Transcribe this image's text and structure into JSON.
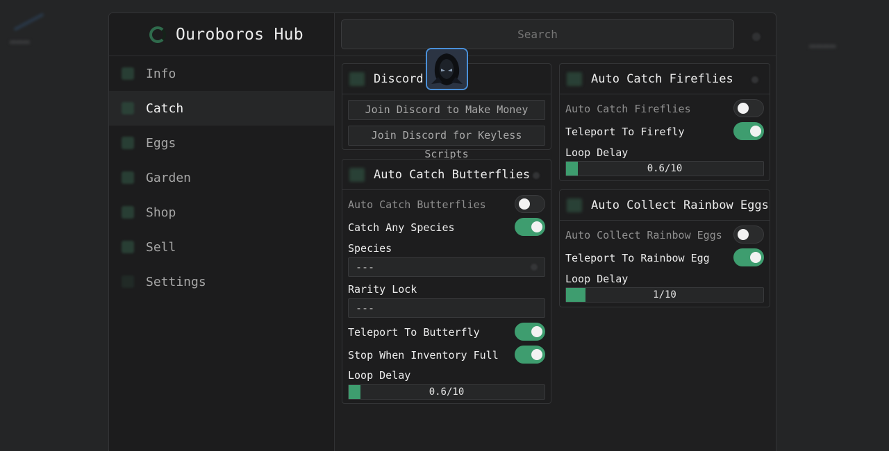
{
  "app": {
    "title": "Ouroboros Hub"
  },
  "sidebar": {
    "items": [
      {
        "label": "Info"
      },
      {
        "label": "Catch",
        "active": true
      },
      {
        "label": "Eggs"
      },
      {
        "label": "Garden"
      },
      {
        "label": "Shop"
      },
      {
        "label": "Sell"
      },
      {
        "label": "Settings"
      }
    ]
  },
  "search": {
    "placeholder": "Search"
  },
  "discord": {
    "title": "Discord",
    "button_money": "Join Discord to Make Money",
    "button_keyless": "Join Discord for Keyless Scripts"
  },
  "butterflies": {
    "title": "Auto Catch Butterflies",
    "auto_catch_label": "Auto Catch Butterflies",
    "auto_catch_on": false,
    "any_species_label": "Catch Any Species",
    "any_species_on": true,
    "species_label": "Species",
    "species_value": "---",
    "rarity_label": "Rarity Lock",
    "rarity_value": "---",
    "teleport_label": "Teleport To Butterfly",
    "teleport_on": true,
    "stop_full_label": "Stop When Inventory Full",
    "stop_full_on": true,
    "delay_label": "Loop Delay",
    "delay_text": "0.6/10",
    "delay_fraction": 0.06
  },
  "fireflies": {
    "title": "Auto Catch Fireflies",
    "auto_catch_label": "Auto Catch Fireflies",
    "auto_catch_on": false,
    "teleport_label": "Teleport To Firefly",
    "teleport_on": true,
    "delay_label": "Loop Delay",
    "delay_text": "0.6/10",
    "delay_fraction": 0.06
  },
  "rainbow": {
    "title": "Auto Collect Rainbow Eggs",
    "auto_collect_label": "Auto Collect Rainbow Eggs",
    "auto_collect_on": false,
    "teleport_label": "Teleport To Rainbow Egg",
    "teleport_on": true,
    "delay_label": "Loop Delay",
    "delay_text": "1/10",
    "delay_fraction": 0.1
  },
  "colors": {
    "accent": "#3e9d6f",
    "avatar_border": "#4a90d9"
  }
}
